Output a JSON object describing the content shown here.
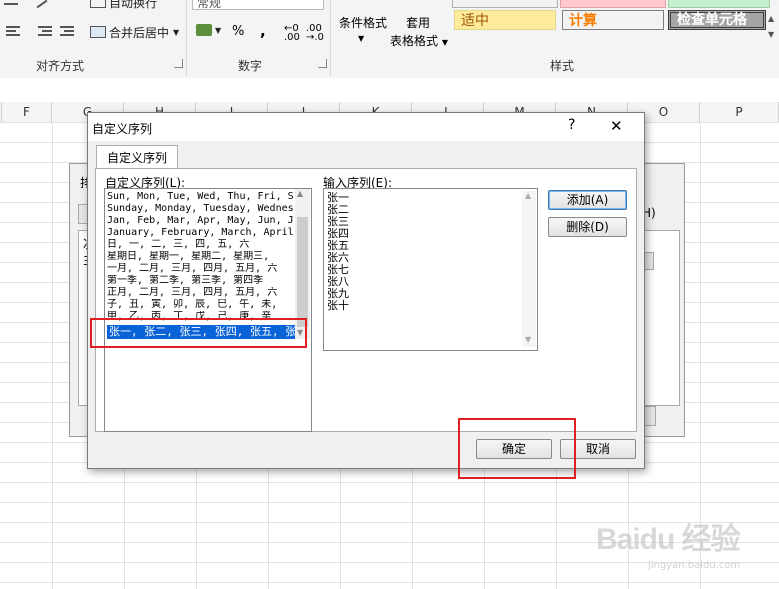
{
  "ribbon": {
    "group_alignment": "对齐方式",
    "group_number": "数字",
    "group_styles": "样式",
    "wrap_text": "自动换行",
    "merge_center": "合并后居中",
    "number_format": "常规",
    "percent": "%",
    "comma": ",",
    "cond_format": "条件格式",
    "table_format_1": "套用",
    "table_format_2": "表格格式",
    "style_neutral": "适中",
    "style_calc": "计算",
    "style_check": "检查单元格"
  },
  "columns": [
    "F",
    "G",
    "H",
    "I",
    "J",
    "K",
    "L",
    "M",
    "N",
    "O",
    "P"
  ],
  "dialog": {
    "title": "自定义序列",
    "help": "?",
    "close": "✕",
    "tab_label": "自定义序列",
    "custom_lists_label": "自定义序列(L):",
    "input_label": "输入序列(E):",
    "lists": [
      "Sun, Mon, Tue, Wed, Thu, Fri, S",
      "Sunday, Monday, Tuesday, Wednes",
      "Jan, Feb, Mar, Apr, May, Jun, J",
      "January, February, March, April",
      "日, 一, 二, 三, 四, 五, 六",
      "星期日, 星期一, 星期二, 星期三,",
      "一月, 二月, 三月, 四月, 五月, 六",
      "第一季, 第二季, 第三季, 第四季",
      "正月, 二月, 三月, 四月, 五月, 六",
      "子, 丑, 寅, 卯, 辰, 巳, 午, 未,",
      "甲, 乙, 丙, 丁, 戊, 己, 庚, 辛"
    ],
    "selected_list": "张一, 张二, 张三, 张四, 张五, 张",
    "entries": [
      "张一",
      "张二",
      "张三",
      "张四",
      "张五",
      "张六",
      "张七",
      "张八",
      "张九",
      "张十"
    ],
    "add_button": "添加(A)",
    "delete_button": "删除(D)",
    "ok_button": "确定",
    "cancel_button": "取消"
  },
  "background_dialog": {
    "label_fragment_1": "排",
    "label_fragment_2": "次",
    "label_fragment_3": "主",
    "right_fragment": "H)"
  },
  "watermark": {
    "brand": "Baidu 经验",
    "url": "jingyan.baidu.com"
  },
  "colors": {
    "selection": "#0a64d8",
    "highlight_box": "#e02020",
    "style_neutral_bg": "#ffeb9c",
    "style_calc_bg": "#f2f2f2",
    "style_check_bg": "#a5a5a5"
  }
}
